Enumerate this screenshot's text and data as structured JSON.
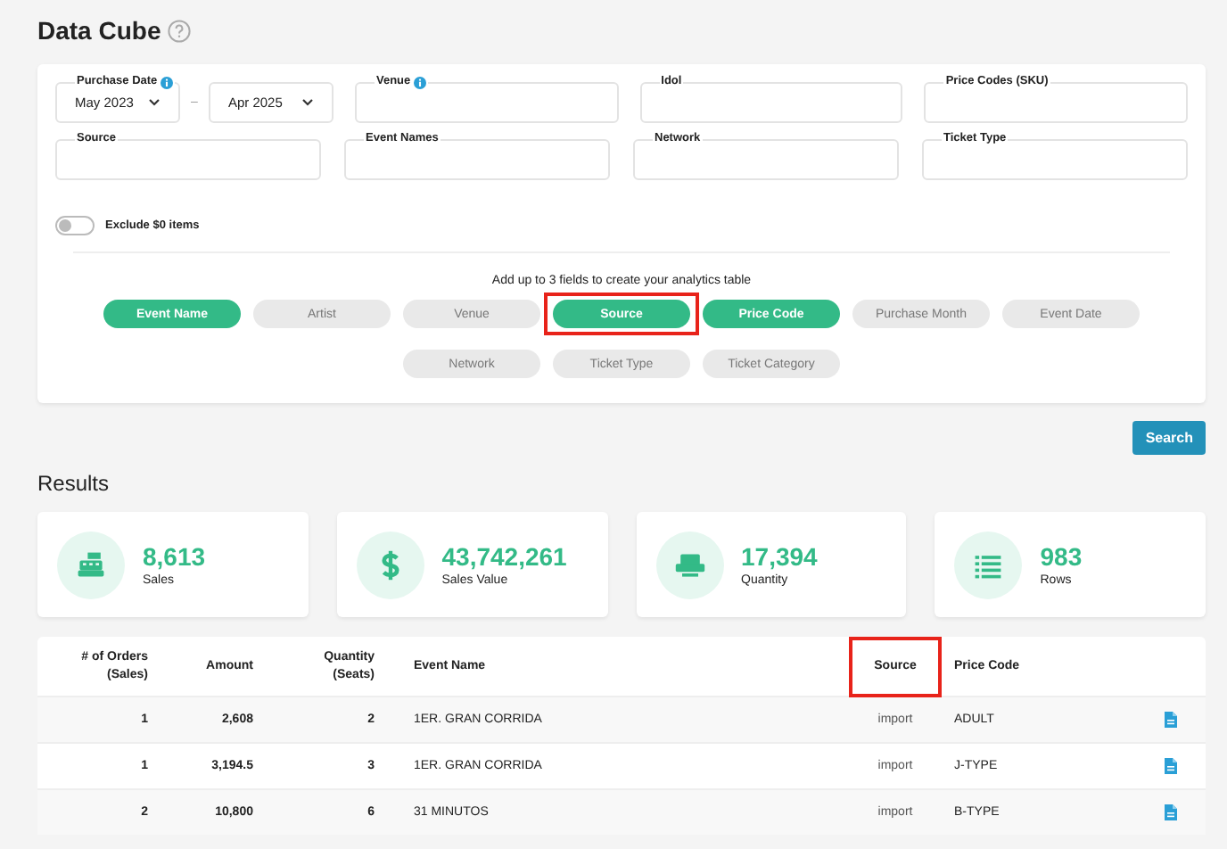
{
  "title": "Data Cube",
  "date_range": {
    "label": "Purchase Date",
    "info": true,
    "from": "May 2023",
    "to": "Apr 2025",
    "separator": "–"
  },
  "fields": [
    {
      "label": "Venue",
      "info": true
    },
    {
      "label": "Idol",
      "info": false
    },
    {
      "label": "Price Codes (SKU)",
      "info": false
    },
    {
      "label": "Source",
      "info": false
    },
    {
      "label": "Event Names",
      "info": false
    },
    {
      "label": "Network",
      "info": false
    },
    {
      "label": "Ticket Type",
      "info": false
    }
  ],
  "exclude_zero": {
    "label": "Exclude $0 items",
    "on": false
  },
  "chips_hint": "Add up to 3 fields to create your analytics table",
  "chips": [
    {
      "label": "Event Name",
      "selected": true,
      "highlighted": false
    },
    {
      "label": "Artist",
      "selected": false,
      "highlighted": false
    },
    {
      "label": "Venue",
      "selected": false,
      "highlighted": false
    },
    {
      "label": "Source",
      "selected": true,
      "highlighted": true
    },
    {
      "label": "Price Code",
      "selected": true,
      "highlighted": false
    },
    {
      "label": "Purchase Month",
      "selected": false,
      "highlighted": false
    },
    {
      "label": "Event Date",
      "selected": false,
      "highlighted": false
    },
    {
      "label": "Network",
      "selected": false,
      "highlighted": false
    },
    {
      "label": "Ticket Type",
      "selected": false,
      "highlighted": false
    },
    {
      "label": "Ticket Category",
      "selected": false,
      "highlighted": false
    }
  ],
  "search_button": "Search",
  "results_title": "Results",
  "stats": [
    {
      "kind": "register",
      "value": "8,613",
      "label": "Sales"
    },
    {
      "kind": "dollar",
      "value": "43,742,261",
      "label": "Sales Value"
    },
    {
      "kind": "seat",
      "value": "17,394",
      "label": "Quantity"
    },
    {
      "kind": "list",
      "value": "983",
      "label": "Rows"
    }
  ],
  "table": {
    "columns": [
      {
        "label": "# of Orders\n(Sales)",
        "highlighted": false
      },
      {
        "label": "Amount",
        "highlighted": false
      },
      {
        "label": "Quantity\n(Seats)",
        "highlighted": false
      },
      {
        "label": "Event Name",
        "highlighted": false
      },
      {
        "label": "Source",
        "highlighted": true
      },
      {
        "label": "Price Code",
        "highlighted": false
      }
    ],
    "rows": [
      [
        "1",
        "2,608",
        "2",
        "1ER. GRAN CORRIDA",
        "import",
        "ADULT"
      ],
      [
        "1",
        "3,194.5",
        "3",
        "1ER. GRAN CORRIDA",
        "import",
        "J-TYPE"
      ],
      [
        "2",
        "10,800",
        "6",
        "31 MINUTOS",
        "import",
        "B-TYPE"
      ]
    ]
  }
}
